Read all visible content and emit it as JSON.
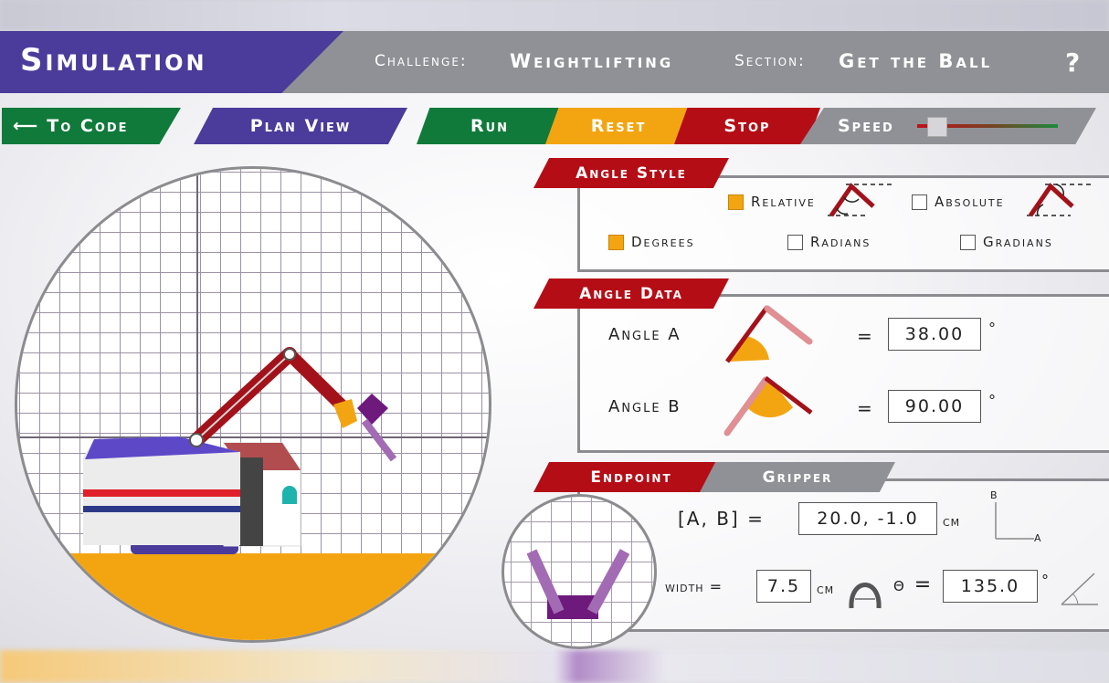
{
  "header": {
    "title": "Simulation",
    "challenge_label": "Challenge:",
    "challenge_value": "Weightlifting",
    "section_label": "Section:",
    "section_value": "Get the Ball",
    "help": "?"
  },
  "toolbar": {
    "to_code": "To Code",
    "plan_view": "Plan View",
    "run": "Run",
    "reset": "Reset",
    "stop": "Stop",
    "speed_label": "Speed",
    "speed_level": 0.15
  },
  "angle_style": {
    "tag": "Angle Style",
    "relative": "Relative",
    "absolute": "Absolute",
    "degrees": "Degrees",
    "radians": "Radians",
    "gradians": "Gradians",
    "relative_checked": true,
    "absolute_checked": false,
    "degrees_checked": true,
    "radians_checked": false,
    "gradians_checked": false
  },
  "angle_data": {
    "tag": "Angle Data",
    "angle_a_label": "Angle A",
    "angle_a_value": "38.00",
    "angle_b_label": "Angle B",
    "angle_b_value": "90.00",
    "equals": "=",
    "degree_symbol": "°"
  },
  "endpoint": {
    "tab_endpoint": "Endpoint",
    "tab_gripper": "Gripper",
    "ab_label": "[A, B] =",
    "ab_value": "20.0, -1.0",
    "ab_unit": "cm",
    "axis_b": "B",
    "axis_a": "A",
    "width_label": "width =",
    "width_value": "7.5",
    "width_unit": "cm",
    "theta_label": "θ =",
    "theta_value": "135.0",
    "degree_symbol": "°"
  },
  "colors": {
    "purple": "#4b3b9a",
    "green": "#107a3a",
    "orange": "#f3a511",
    "red": "#b50d16",
    "gray": "#8f9196"
  }
}
